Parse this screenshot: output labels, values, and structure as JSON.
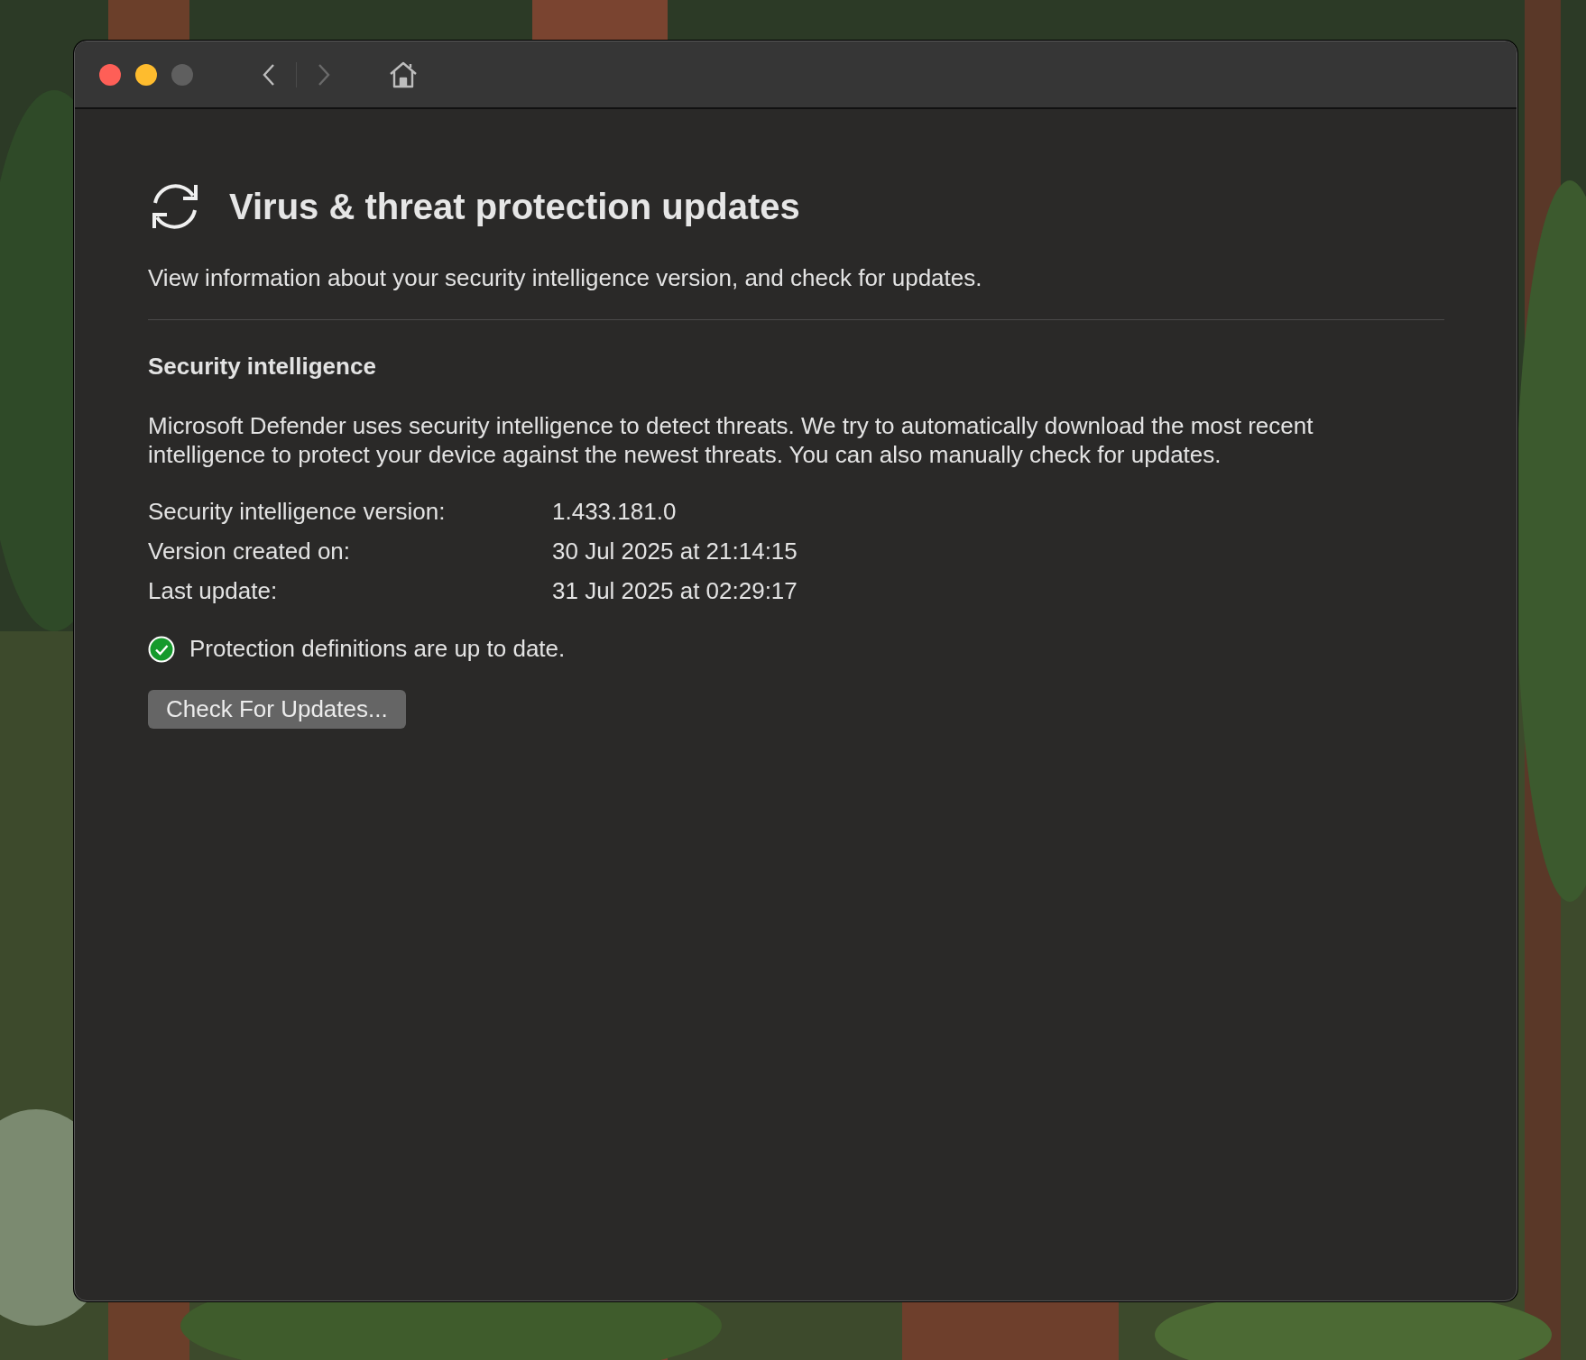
{
  "window_controls": [
    {
      "kind": "close",
      "disabled": false
    },
    {
      "kind": "minimize",
      "disabled": false
    },
    {
      "kind": "zoom",
      "disabled": true
    }
  ],
  "toolbar": {
    "back": {
      "disabled": false
    },
    "forward": {
      "disabled": true
    }
  },
  "header": {
    "title": "Virus & threat protection updates",
    "subtitle": "View information about your security intelligence version, and check for updates."
  },
  "section": {
    "heading": "Security intelligence",
    "description": "Microsoft Defender uses security intelligence to detect threats. We try to automatically download the most recent intelligence to protect your device against the newest threats. You can also manually check for updates.",
    "details": [
      {
        "label": "Security intelligence version:",
        "value": "1.433.181.0"
      },
      {
        "label": "Version created on:",
        "value": "30 Jul 2025 at 21:14:15"
      },
      {
        "label": "Last update:",
        "value": "31 Jul 2025 at 02:29:17"
      }
    ],
    "status": {
      "kind": "ok",
      "text": "Protection definitions are up to date."
    },
    "button": "Check For Updates..."
  }
}
